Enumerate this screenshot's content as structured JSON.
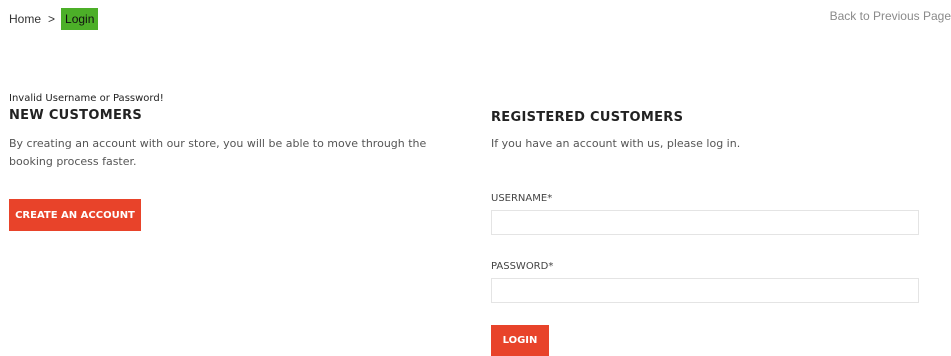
{
  "breadcrumb": {
    "home": "Home",
    "separator": ">",
    "current": "Login"
  },
  "back_link": "Back to Previous Page",
  "error_message": "Invalid Username or Password!",
  "new_customers": {
    "title": "NEW CUSTOMERS",
    "description": "By creating an account with our store, you will be able to move through the booking process faster.",
    "button_label": "CREATE AN ACCOUNT"
  },
  "registered_customers": {
    "title": "REGISTERED CUSTOMERS",
    "description": "If you have an account with us, please log in.",
    "username_label": "USERNAME*",
    "username_value": "",
    "password_label": "PASSWORD*",
    "password_value": "",
    "login_label": "LOGIN"
  },
  "colors": {
    "accent": "#e8432a",
    "breadcrumb_highlight": "#4caf28",
    "muted_link": "#8a8a8a"
  }
}
